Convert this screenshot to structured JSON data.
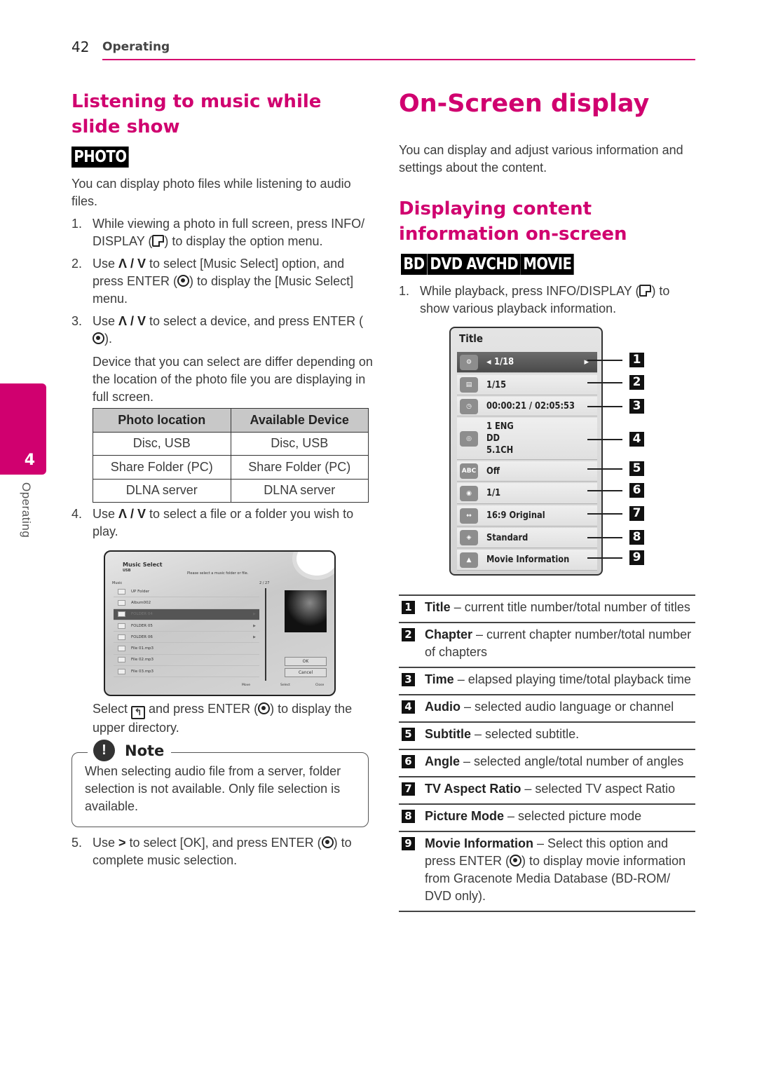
{
  "header": {
    "page_number": "42",
    "section": "Operating"
  },
  "side_tab": {
    "chapter_number": "4",
    "label": "Operating"
  },
  "left": {
    "heading": "Listening to music while slide show",
    "badge": "PHOTO",
    "intro": "You can display photo files while listening to audio files.",
    "steps": [
      {
        "num": "1.",
        "parts": [
          "While viewing a photo in full screen, press INFO/ DISPLAY (",
          ") to display the option menu."
        ]
      },
      {
        "num": "2.",
        "parts": [
          "Use ",
          "Λ / V",
          " to select [Music Select] option, and press ENTER (",
          ") to display the [Music Select] menu."
        ]
      },
      {
        "num": "3.",
        "parts": [
          "Use ",
          "Λ / V",
          " to select a device, and press ENTER (",
          ")."
        ]
      },
      {
        "num": "4.",
        "parts": [
          "Use ",
          "Λ / V",
          " to select a file or a folder you wish to play."
        ]
      },
      {
        "num": "5.",
        "parts": [
          "Use ",
          ">",
          " to select [OK], and press ENTER (",
          ") to complete music selection."
        ]
      }
    ],
    "step3_note": "Device that you can select are differ depending on the location of the photo file you are displaying in full screen.",
    "table": {
      "headers": [
        "Photo location",
        "Available Device"
      ],
      "rows": [
        [
          "Disc, USB",
          "Disc, USB"
        ],
        [
          "Share Folder (PC)",
          "Share Folder (PC)"
        ],
        [
          "DLNA server",
          "DLNA server"
        ]
      ]
    },
    "music_select_screen": {
      "title": "Music Select",
      "device": "USB",
      "prompt": "Please select a music folder or file.",
      "list_label": "Music",
      "count": "2 / 27",
      "items": [
        "UP Folder",
        "Album002",
        "FOLDER 04",
        "FOLDER 05",
        "FOLDER 06",
        "File 01.mp3",
        "File 02.mp3",
        "File 03.mp3"
      ],
      "selected_index": 2,
      "ok_label": "OK",
      "cancel_label": "Cancel",
      "footer": [
        "Move",
        "Select",
        "Close"
      ]
    },
    "upper_dir": {
      "before": "Select ",
      "mid": " and press ENTER (",
      "after": ") to display the upper directory.",
      "icon": "up-folder-icon"
    },
    "note": {
      "title": "Note",
      "text": "When selecting audio file from a server, folder selection is not available. Only file selection is available."
    }
  },
  "right": {
    "heading": "On-Screen display",
    "intro": "You can display and adjust various information and settings about the content.",
    "subheading": "Displaying content information on-screen",
    "badges": [
      "BD",
      "DVD",
      "AVCHD",
      "MOVIE"
    ],
    "step1": {
      "num": "1.",
      "before": "While playback, press INFO/DISPLAY (",
      "after": ") to show various playback information."
    },
    "osd": {
      "title": "Title",
      "rows": [
        {
          "icon": "film-reel-icon",
          "value": "1/18",
          "num": "1"
        },
        {
          "icon": "clapper-icon",
          "value": "1/15",
          "num": "2"
        },
        {
          "icon": "clock-icon",
          "value": "00:00:21 / 02:05:53",
          "num": "3"
        },
        {
          "icon": "speaker-icon",
          "value": "1 ENG\nDD\n5.1CH",
          "num": "4"
        },
        {
          "icon": "abc-subtitle-icon",
          "value": "Off",
          "num": "5"
        },
        {
          "icon": "camera-angle-icon",
          "value": "1/1",
          "num": "6"
        },
        {
          "icon": "aspect-ratio-icon",
          "value": "16:9 Original",
          "num": "7"
        },
        {
          "icon": "palette-icon",
          "value": "Standard",
          "num": "8"
        },
        {
          "icon": "gracenote-icon",
          "value": "Movie Information",
          "num": "9"
        }
      ]
    },
    "legend": [
      {
        "num": "1",
        "term": "Title",
        "desc": " – current title number/total number of titles"
      },
      {
        "num": "2",
        "term": "Chapter",
        "desc": " – current chapter number/total number of chapters"
      },
      {
        "num": "3",
        "term": "Time",
        "desc": " – elapsed playing time/total playback time"
      },
      {
        "num": "4",
        "term": "Audio",
        "desc": " – selected audio language or channel"
      },
      {
        "num": "5",
        "term": "Subtitle",
        "desc": " – selected subtitle."
      },
      {
        "num": "6",
        "term": "Angle",
        "desc": " – selected angle/total number of angles"
      },
      {
        "num": "7",
        "term": "TV Aspect Ratio",
        "desc": " – selected TV aspect Ratio"
      },
      {
        "num": "8",
        "term": "Picture Mode",
        "desc": " – selected picture mode"
      },
      {
        "num": "9",
        "term": "Movie Information",
        "desc": " – Select this option and press ENTER (",
        "desc2": ") to display movie information from Gracenote Media Database (BD-ROM/ DVD only)."
      }
    ]
  },
  "colors": {
    "accent": "#d0006f",
    "badge_bg": "#000000",
    "text": "#3c3c3c"
  }
}
